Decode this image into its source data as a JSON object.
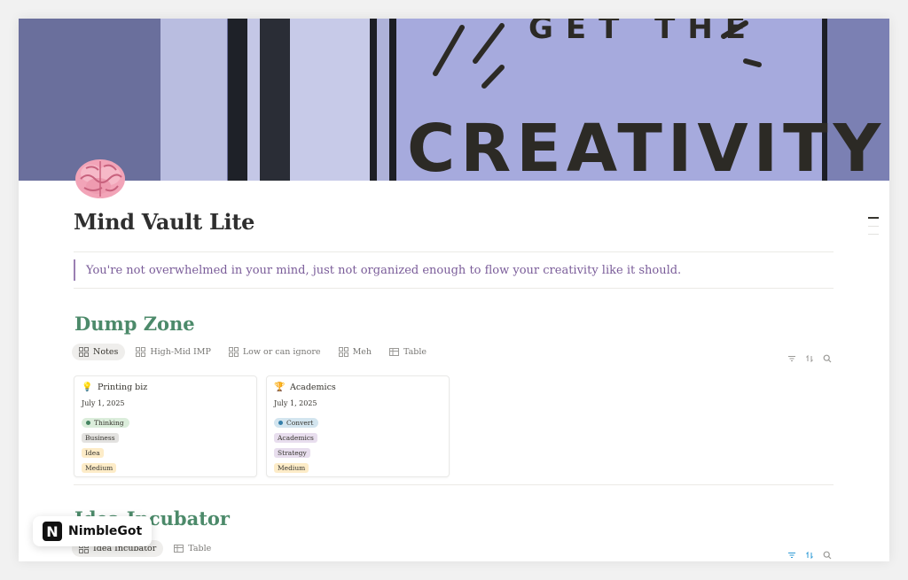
{
  "cover": {
    "text_top": "GET THE",
    "text_main": "CREATIVITY"
  },
  "page": {
    "icon": "brain-emoji",
    "title": "Mind Vault Lite",
    "quote": "You're not overwhelmed in your mind, just not organized enough to flow your creativity like it should."
  },
  "dump_zone": {
    "title": "Dump Zone",
    "views": [
      {
        "label": "Notes",
        "icon": "gallery-icon",
        "active": true
      },
      {
        "label": "High-Mid IMP",
        "icon": "gallery-icon"
      },
      {
        "label": "Low or can ignore",
        "icon": "gallery-icon"
      },
      {
        "label": "Meh",
        "icon": "gallery-icon"
      },
      {
        "label": "Table",
        "icon": "table-icon"
      }
    ],
    "cards": [
      {
        "emoji": "💡",
        "title": "Printing biz",
        "date": "July 1, 2025",
        "status": "Thinking",
        "status_color": "#448361",
        "status_bg": "#dbeddb",
        "tags": [
          {
            "text": "Business",
            "bg": "#e3e2e0"
          },
          {
            "text": "Idea",
            "bg": "#fdecc8"
          },
          {
            "text": "Medium",
            "bg": "#fdecc8"
          }
        ]
      },
      {
        "emoji": "🏆",
        "title": "Academics",
        "date": "July 1, 2025",
        "status": "Convert",
        "status_color": "#337ea9",
        "status_bg": "#d3e5ef",
        "tags": [
          {
            "text": "Academics",
            "bg": "#e8deee"
          },
          {
            "text": "Strategy",
            "bg": "#e8deee"
          },
          {
            "text": "Medium",
            "bg": "#fdecc8"
          }
        ]
      }
    ]
  },
  "idea_incubator": {
    "title": "Idea Incubator",
    "views": [
      {
        "label": "Idea Incubator",
        "icon": "gallery-icon",
        "active": true
      },
      {
        "label": "Table",
        "icon": "table-icon"
      }
    ]
  },
  "watermark": {
    "logo_letter": "N",
    "text": "NimbleGot"
  },
  "colors": {
    "accent_green": "#4c8a6a",
    "quote_purple": "#7a5c99",
    "tool_blue": "#2e9bd6"
  }
}
